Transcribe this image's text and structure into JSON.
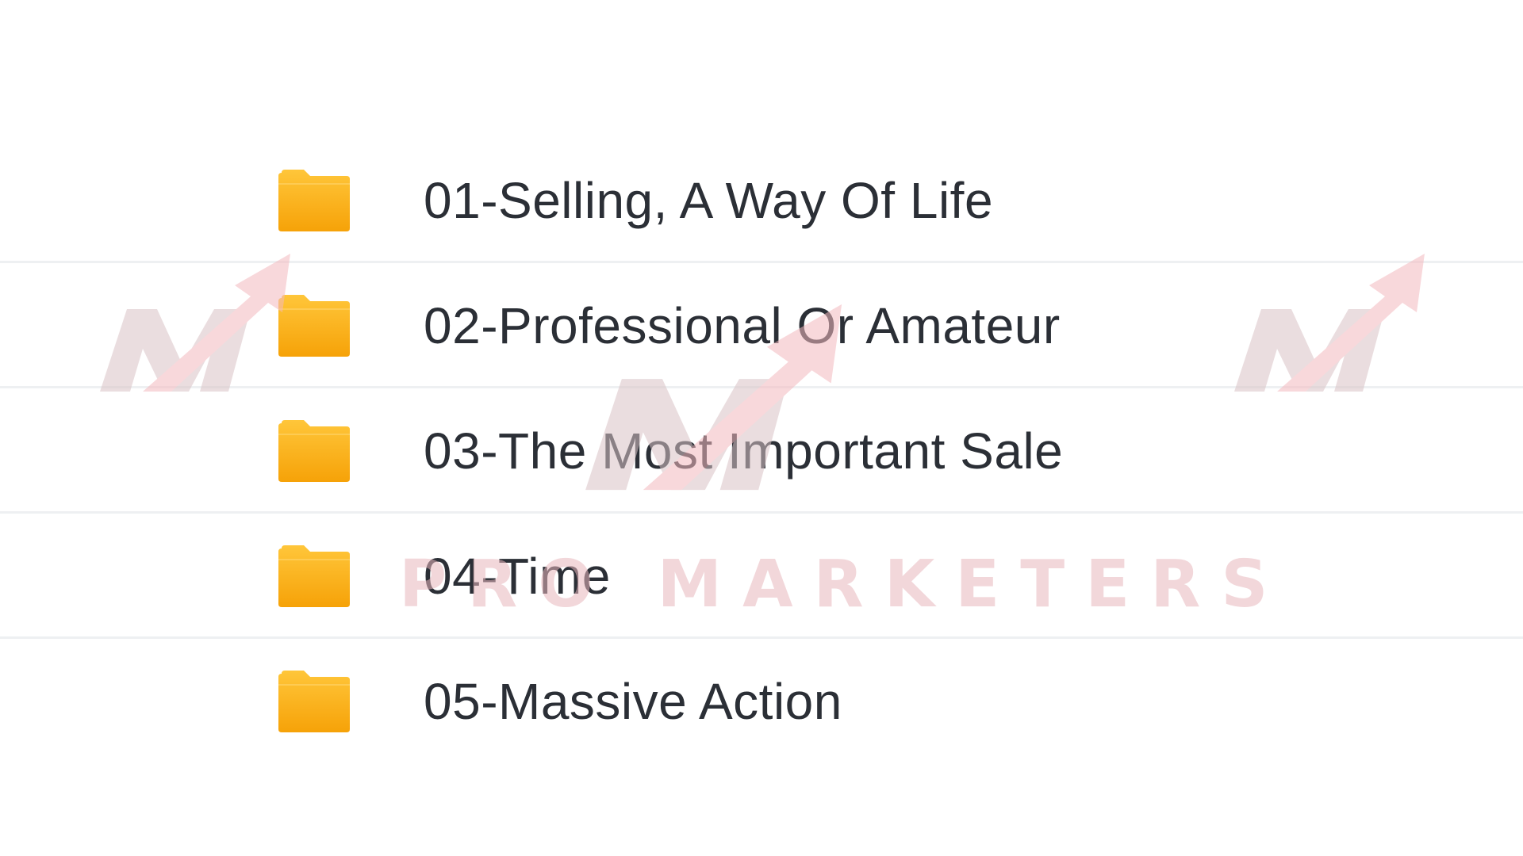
{
  "folders": [
    {
      "name": "01-Selling, A Way Of Life",
      "icon": "folder-icon"
    },
    {
      "name": "02-Professional Or Amateur",
      "icon": "folder-icon"
    },
    {
      "name": "03-The Most Important Sale",
      "icon": "folder-icon"
    },
    {
      "name": "04-Time",
      "icon": "folder-icon"
    },
    {
      "name": "05-Massive Action",
      "icon": "folder-icon"
    }
  ],
  "watermark": {
    "text": "PRO MARKETERS",
    "icon": "pro-marketers-logo-icon"
  },
  "colors": {
    "folder_top": "#ffc63a",
    "folder_bottom": "#f6a208",
    "text": "#2b2f36",
    "divider": "#eef0f2",
    "watermark_arrow": "#f4b9bf",
    "watermark_m": "#d9c3c6"
  }
}
